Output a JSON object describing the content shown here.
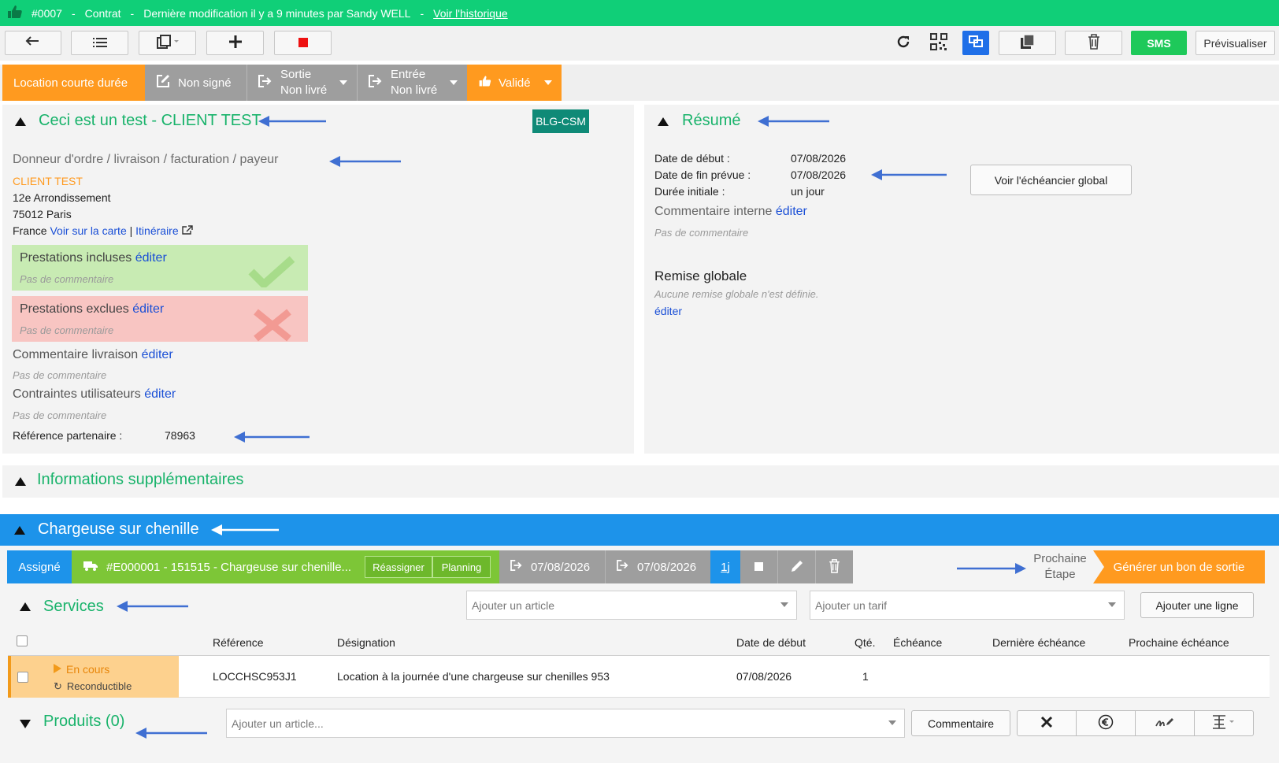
{
  "topbar": {
    "id": "#0007",
    "sep1": "-",
    "type": "Contrat",
    "sep2": "-",
    "modified": "Dernière modification il y a 9 minutes par Sandy WELL",
    "sep3": "-",
    "history_link": "Voir l'historique"
  },
  "toolbar": {
    "sms_label": "SMS",
    "preview_label": "Prévisualiser"
  },
  "status": {
    "location": "Location courte durée",
    "signed": "Non signé",
    "sortie_title": "Sortie",
    "sortie_value": "Non livré",
    "entree_title": "Entrée",
    "entree_value": "Non livré",
    "validated": "Validé"
  },
  "client_panel": {
    "title": "Ceci est un test - CLIENT TEST",
    "badge": "BLG-CSM",
    "section_label": "Donneur d'ordre / livraison / facturation / payeur",
    "client_name": "CLIENT TEST",
    "address_line1": "12e Arrondissement",
    "address_line2": "75012 Paris",
    "country": "France",
    "map_link": "Voir sur la carte",
    "pipe": "|",
    "itinerary_link": "Itinéraire",
    "included_label": "Prestations incluses",
    "excluded_label": "Prestations exclues",
    "edit": "éditer",
    "no_comment": "Pas de commentaire",
    "delivery_comment_label": "Commentaire livraison",
    "user_constraints_label": "Contraintes utilisateurs",
    "partner_ref_label": "Référence partenaire :",
    "partner_ref_value": "78963"
  },
  "summary_panel": {
    "title": "Résumé",
    "start_label": "Date de début :",
    "start_value": "07/08/2026",
    "end_label": "Date de fin prévue :",
    "end_value": "07/08/2026",
    "duration_label": "Durée initiale :",
    "duration_value": "un jour",
    "schedule_button": "Voir l'échéancier global",
    "internal_comment_label": "Commentaire interne",
    "edit": "éditer",
    "no_comment": "Pas de commentaire",
    "discount_title": "Remise globale",
    "discount_text": "Aucune remise globale n'est définie.",
    "discount_edit": "éditer"
  },
  "extra_info": {
    "title": "Informations supplémentaires"
  },
  "equipment": {
    "title": "Chargeuse sur chenille",
    "assigned": "Assigné",
    "item": "#E000001 - 151515 - Chargeuse sur chenille...",
    "reassign": "Réassigner",
    "planning": "Planning",
    "out_date": "07/08/2026",
    "in_date": "07/08/2026",
    "duration": "1j",
    "next_step_line1": "Prochaine",
    "next_step_line2": "Étape",
    "generate_button": "Générer un bon de sortie"
  },
  "services": {
    "title": "Services",
    "add_article_placeholder": "Ajouter un article",
    "add_tarif_placeholder": "Ajouter un tarif",
    "add_line_button": "Ajouter une ligne",
    "columns": [
      "Référence",
      "Désignation",
      "Date de début",
      "Qté.",
      "Échéance",
      "Dernière échéance",
      "Prochaine échéance"
    ],
    "rows": [
      {
        "status": "En cours",
        "recurrence": "Reconductible",
        "reference": "LOCCHSC953J1",
        "designation": "Location à la journée d'une chargeuse sur chenilles 953",
        "start": "07/08/2026",
        "qty": "1",
        "due": "",
        "last_due": "",
        "next_due": ""
      }
    ]
  },
  "products": {
    "title": "Produits (0)",
    "add_article_placeholder": "Ajouter un article...",
    "comment_button": "Commentaire"
  },
  "colors": {
    "topbar": "#10cf78",
    "orange": "#ff9a1f",
    "gray_segment": "#9e9e9e",
    "green_btn": "#1ec95a",
    "blue_section": "#1d93ea",
    "section_title": "#19b36b",
    "teal_badge": "#0f8a77",
    "link": "#1a4fd6",
    "arrow": "#3f6fd2"
  },
  "icons": [
    "thumbs-up-icon",
    "back-arrow-icon",
    "list-icon",
    "copy-icon",
    "plus-icon",
    "stop-icon",
    "refresh-icon",
    "qr-code-icon",
    "linked-windows-icon",
    "duplicate-icon",
    "trash-icon",
    "edit-icon",
    "exit-icon",
    "enter-icon",
    "external-link-icon",
    "truck-icon",
    "pencil-icon",
    "close-icon",
    "euro-icon",
    "signature-icon",
    "split-icon"
  ]
}
